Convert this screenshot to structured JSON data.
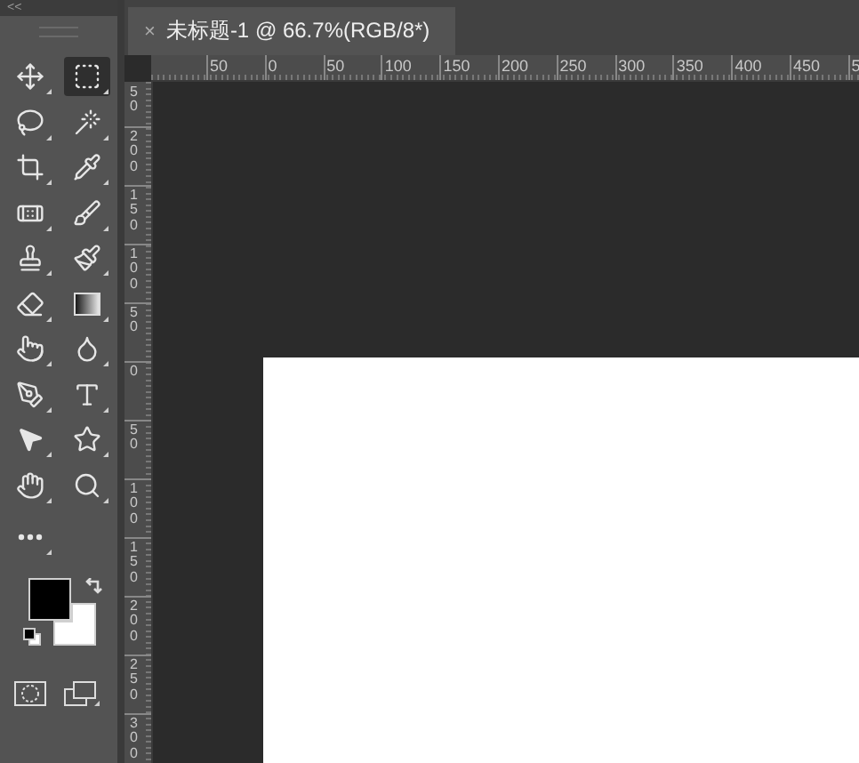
{
  "panel": {
    "collapse": "<<"
  },
  "tabs": [
    {
      "title": "未标题-1 @ 66.7%(RGB/8*)",
      "close": "×",
      "selected": true
    }
  ],
  "toolbar": {
    "tools": [
      {
        "kind": "move",
        "selected": false
      },
      {
        "kind": "marquee",
        "selected": true
      },
      {
        "kind": "lasso",
        "selected": false
      },
      {
        "kind": "wand",
        "selected": false
      },
      {
        "kind": "crop",
        "selected": false
      },
      {
        "kind": "eyedropper",
        "selected": false
      },
      {
        "kind": "bandage",
        "selected": false
      },
      {
        "kind": "brush",
        "selected": false
      },
      {
        "kind": "stamp",
        "selected": false
      },
      {
        "kind": "paintbrush",
        "selected": false
      },
      {
        "kind": "eraser",
        "selected": false
      },
      {
        "kind": "gradient",
        "selected": false
      },
      {
        "kind": "smudge",
        "selected": false
      },
      {
        "kind": "dodge",
        "selected": false
      },
      {
        "kind": "pen",
        "selected": false
      },
      {
        "kind": "type",
        "selected": false
      },
      {
        "kind": "select",
        "selected": false
      },
      {
        "kind": "shape",
        "selected": false
      },
      {
        "kind": "hand",
        "selected": false
      },
      {
        "kind": "zoom",
        "selected": false
      },
      {
        "kind": "more",
        "selected": false
      }
    ],
    "swatches": [
      {
        "kind": "foreground",
        "color": "#000000"
      },
      {
        "kind": "background",
        "color": "#ffffff"
      }
    ]
  },
  "rulers": {
    "horizontal": [
      "50",
      "0",
      "50",
      "100",
      "150",
      "200",
      "250",
      "300",
      "350",
      "400",
      "450",
      "5"
    ],
    "vertical": [
      "50",
      "200",
      "150",
      "100",
      "50",
      "0",
      "50",
      "100",
      "150",
      "200",
      "250",
      "300"
    ]
  }
}
